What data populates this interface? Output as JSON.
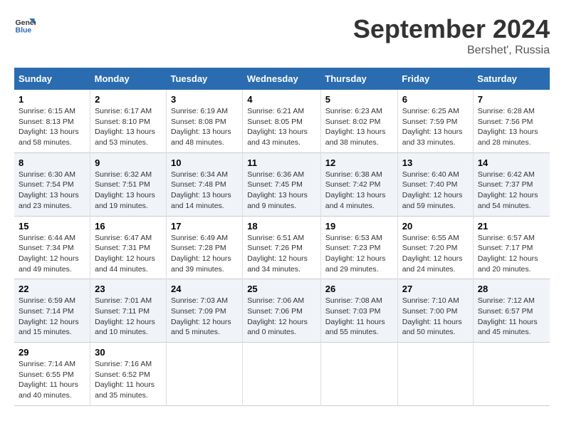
{
  "header": {
    "logo_general": "General",
    "logo_blue": "Blue",
    "month_title": "September 2024",
    "location": "Bershet', Russia"
  },
  "weekdays": [
    "Sunday",
    "Monday",
    "Tuesday",
    "Wednesday",
    "Thursday",
    "Friday",
    "Saturday"
  ],
  "weeks": [
    [
      {
        "day": "1",
        "sunrise": "6:15 AM",
        "sunset": "8:13 PM",
        "daylight": "13 hours and 58 minutes."
      },
      {
        "day": "2",
        "sunrise": "6:17 AM",
        "sunset": "8:10 PM",
        "daylight": "13 hours and 53 minutes."
      },
      {
        "day": "3",
        "sunrise": "6:19 AM",
        "sunset": "8:08 PM",
        "daylight": "13 hours and 48 minutes."
      },
      {
        "day": "4",
        "sunrise": "6:21 AM",
        "sunset": "8:05 PM",
        "daylight": "13 hours and 43 minutes."
      },
      {
        "day": "5",
        "sunrise": "6:23 AM",
        "sunset": "8:02 PM",
        "daylight": "13 hours and 38 minutes."
      },
      {
        "day": "6",
        "sunrise": "6:25 AM",
        "sunset": "7:59 PM",
        "daylight": "13 hours and 33 minutes."
      },
      {
        "day": "7",
        "sunrise": "6:28 AM",
        "sunset": "7:56 PM",
        "daylight": "13 hours and 28 minutes."
      }
    ],
    [
      {
        "day": "8",
        "sunrise": "6:30 AM",
        "sunset": "7:54 PM",
        "daylight": "13 hours and 23 minutes."
      },
      {
        "day": "9",
        "sunrise": "6:32 AM",
        "sunset": "7:51 PM",
        "daylight": "13 hours and 19 minutes."
      },
      {
        "day": "10",
        "sunrise": "6:34 AM",
        "sunset": "7:48 PM",
        "daylight": "13 hours and 14 minutes."
      },
      {
        "day": "11",
        "sunrise": "6:36 AM",
        "sunset": "7:45 PM",
        "daylight": "13 hours and 9 minutes."
      },
      {
        "day": "12",
        "sunrise": "6:38 AM",
        "sunset": "7:42 PM",
        "daylight": "13 hours and 4 minutes."
      },
      {
        "day": "13",
        "sunrise": "6:40 AM",
        "sunset": "7:40 PM",
        "daylight": "12 hours and 59 minutes."
      },
      {
        "day": "14",
        "sunrise": "6:42 AM",
        "sunset": "7:37 PM",
        "daylight": "12 hours and 54 minutes."
      }
    ],
    [
      {
        "day": "15",
        "sunrise": "6:44 AM",
        "sunset": "7:34 PM",
        "daylight": "12 hours and 49 minutes."
      },
      {
        "day": "16",
        "sunrise": "6:47 AM",
        "sunset": "7:31 PM",
        "daylight": "12 hours and 44 minutes."
      },
      {
        "day": "17",
        "sunrise": "6:49 AM",
        "sunset": "7:28 PM",
        "daylight": "12 hours and 39 minutes."
      },
      {
        "day": "18",
        "sunrise": "6:51 AM",
        "sunset": "7:26 PM",
        "daylight": "12 hours and 34 minutes."
      },
      {
        "day": "19",
        "sunrise": "6:53 AM",
        "sunset": "7:23 PM",
        "daylight": "12 hours and 29 minutes."
      },
      {
        "day": "20",
        "sunrise": "6:55 AM",
        "sunset": "7:20 PM",
        "daylight": "12 hours and 24 minutes."
      },
      {
        "day": "21",
        "sunrise": "6:57 AM",
        "sunset": "7:17 PM",
        "daylight": "12 hours and 20 minutes."
      }
    ],
    [
      {
        "day": "22",
        "sunrise": "6:59 AM",
        "sunset": "7:14 PM",
        "daylight": "12 hours and 15 minutes."
      },
      {
        "day": "23",
        "sunrise": "7:01 AM",
        "sunset": "7:11 PM",
        "daylight": "12 hours and 10 minutes."
      },
      {
        "day": "24",
        "sunrise": "7:03 AM",
        "sunset": "7:09 PM",
        "daylight": "12 hours and 5 minutes."
      },
      {
        "day": "25",
        "sunrise": "7:06 AM",
        "sunset": "7:06 PM",
        "daylight": "12 hours and 0 minutes."
      },
      {
        "day": "26",
        "sunrise": "7:08 AM",
        "sunset": "7:03 PM",
        "daylight": "11 hours and 55 minutes."
      },
      {
        "day": "27",
        "sunrise": "7:10 AM",
        "sunset": "7:00 PM",
        "daylight": "11 hours and 50 minutes."
      },
      {
        "day": "28",
        "sunrise": "7:12 AM",
        "sunset": "6:57 PM",
        "daylight": "11 hours and 45 minutes."
      }
    ],
    [
      {
        "day": "29",
        "sunrise": "7:14 AM",
        "sunset": "6:55 PM",
        "daylight": "11 hours and 40 minutes."
      },
      {
        "day": "30",
        "sunrise": "7:16 AM",
        "sunset": "6:52 PM",
        "daylight": "11 hours and 35 minutes."
      },
      null,
      null,
      null,
      null,
      null
    ]
  ]
}
